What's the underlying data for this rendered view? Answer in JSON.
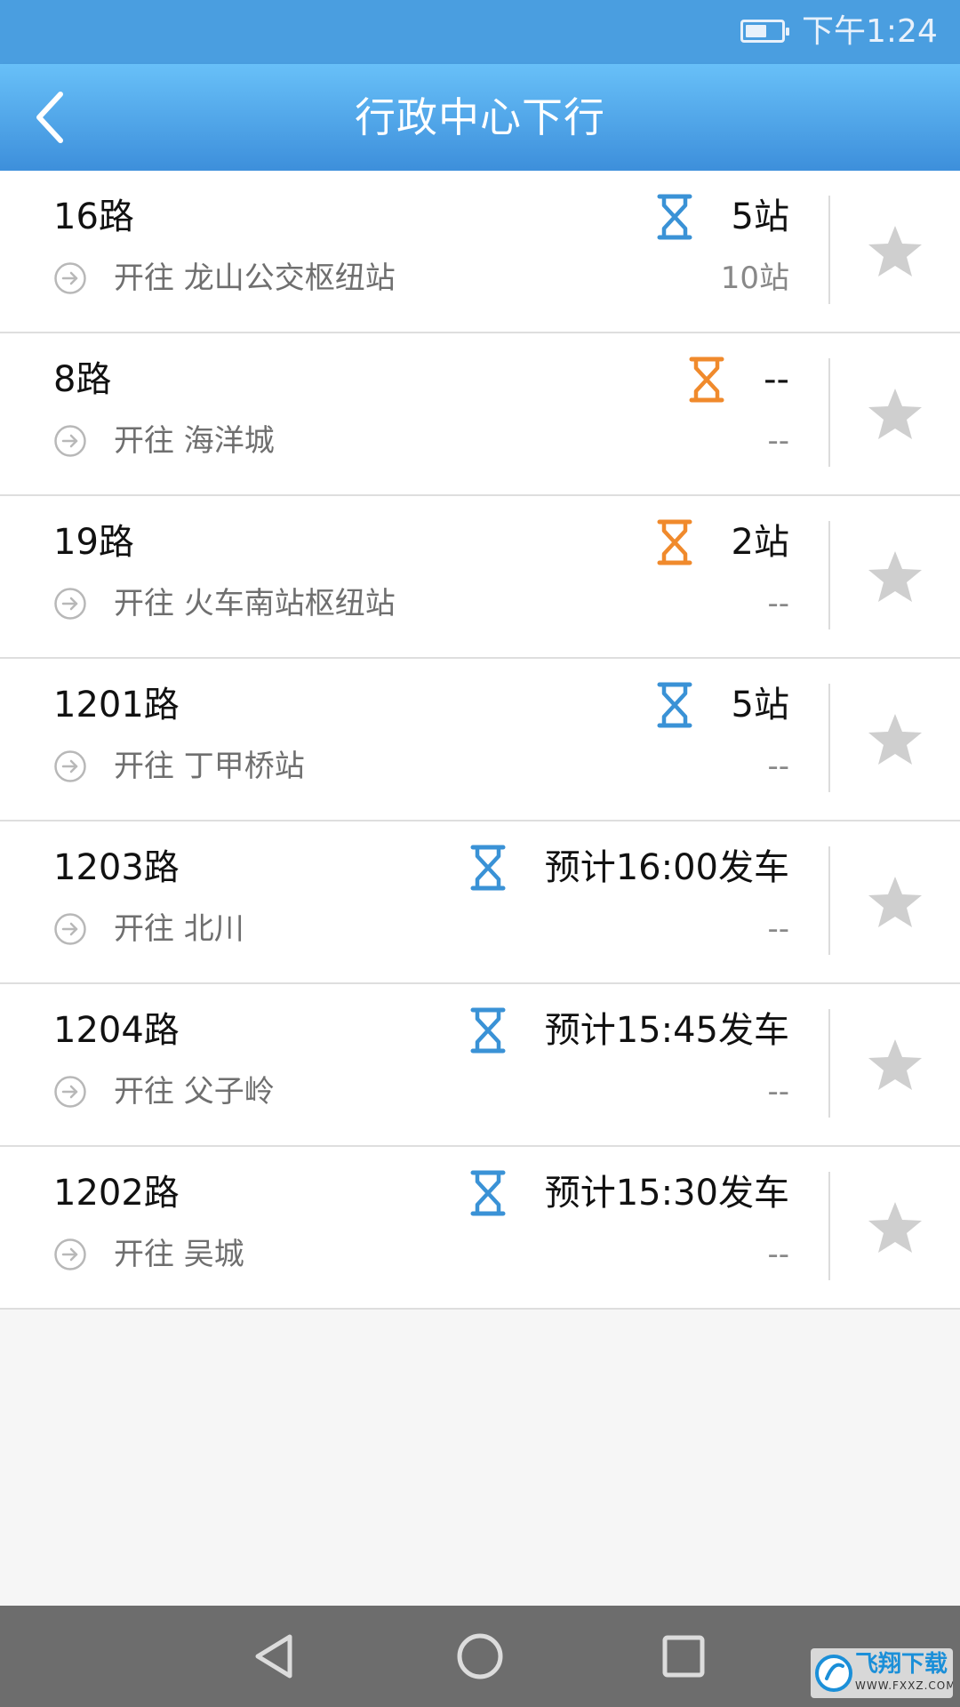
{
  "status_bar": {
    "time": "下午1:24",
    "battery_level": 0.6
  },
  "header": {
    "title": "行政中心下行",
    "back_icon": "chevron-left-icon"
  },
  "colors": {
    "header": "#4a9ee0",
    "hourglass_blue": "#3a92d6",
    "hourglass_orange": "#f08a2c",
    "star": "#cfcfcf"
  },
  "routes": [
    {
      "name": "16路",
      "destination": "开往 龙山公交枢纽站",
      "eta": "5站",
      "distance": "10站",
      "status_color": "blue"
    },
    {
      "name": "8路",
      "destination": "开往 海洋城",
      "eta": "--",
      "distance": "--",
      "status_color": "orange"
    },
    {
      "name": "19路",
      "destination": "开往 火车南站枢纽站",
      "eta": "2站",
      "distance": "--",
      "status_color": "orange"
    },
    {
      "name": "1201路",
      "destination": "开往 丁甲桥站",
      "eta": "5站",
      "distance": "--",
      "status_color": "blue"
    },
    {
      "name": "1203路",
      "destination": "开往 北川",
      "eta": "预计16:00发车",
      "distance": "--",
      "status_color": "blue"
    },
    {
      "name": "1204路",
      "destination": "开往 父子岭",
      "eta": "预计15:45发车",
      "distance": "--",
      "status_color": "blue"
    },
    {
      "name": "1202路",
      "destination": "开往 吴城",
      "eta": "预计15:30发车",
      "distance": "--",
      "status_color": "blue"
    }
  ],
  "nav_bar": {
    "back_icon": "triangle-back-icon",
    "home_icon": "circle-home-icon",
    "recents_icon": "square-recents-icon"
  },
  "watermark": {
    "title": "飞翔下载",
    "url": "WWW.FXXZ.COM"
  }
}
